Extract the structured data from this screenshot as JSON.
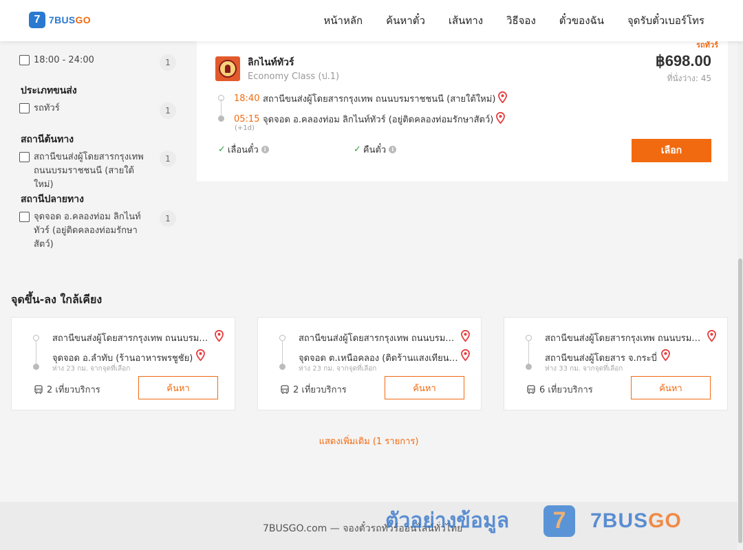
{
  "header": {
    "logo_mark": "7",
    "logo_brand": "7BUS",
    "logo_brand_go": "GO",
    "nav": [
      "หน้าหลัก",
      "ค้นหาตั๋ว",
      "เส้นทาง",
      "วิธีจอง",
      "ตั๋วของฉัน",
      "จุดรับตั๋วเบอร์โทร"
    ]
  },
  "filters": {
    "time": {
      "option": "18:00 - 24:00",
      "count": "1"
    },
    "type": {
      "title": "ประเภทขนส่ง",
      "option": "รถทัวร์",
      "count": "1"
    },
    "origin": {
      "title": "สถานีต้นทาง",
      "option": "สถานีขนส่งผู้โดยสารกรุงเทพ ถนนบรมราชชนนี (สายใต้ใหม่)",
      "count": "1"
    },
    "destination": {
      "title": "สถานีปลายทาง",
      "option": "จุดจอด อ.คลองท่อม ลิกไนท์ทัวร์ (อยู่ติดคลองท่อมรักษาสัตว์)",
      "count": "1"
    }
  },
  "trip": {
    "tag": "รถทัวร์",
    "operator": "ลิกไนท์ทัวร์",
    "class": "Economy Class (ป.1)",
    "price": "฿698.00",
    "seats": "ที่นั่งว่าง: 45",
    "depart_time": "18:40",
    "depart_station": "สถานีขนส่งผู้โดยสารกรุงเทพ ถนนบรมราชชนนี (สายใต้ใหม่)",
    "arrive_time": "05:15",
    "arrive_station": "จุดจอด อ.คลองท่อม ลิกไนท์ทัวร์ (อยู่ติดคลองท่อมรักษาสัตว์)",
    "plus_day": "(+1d)",
    "feature_1": "เลื่อนตั๋ว",
    "feature_2": "คืนตั๋ว",
    "select_label": "เลือก"
  },
  "nearby": {
    "title": "จุดขึ้น-ลง ใกล้เคียง",
    "cards": [
      {
        "from": "สถานีขนส่งผู้โดยสารกรุงเทพ ถนนบรมราชชนนี (สายใต้ใหม่)",
        "to": "จุดจอด อ.ลำทับ (ร้านอาหารพรชูชัย)",
        "distance": "ห่าง 23 กม. จากจุดที่เลือก",
        "trips": "2 เที่ยวบริการ",
        "button": "ค้นหา"
      },
      {
        "from": "สถานีขนส่งผู้โดยสารกรุงเทพ ถนนบรมราชชนนี (สายใต้ใหม่)",
        "to": "จุดจอด ต.เหนือคลอง (ติดร้านแสงเทียนการยาง)",
        "distance": "ห่าง 23 กม. จากจุดที่เลือก",
        "trips": "2 เที่ยวบริการ",
        "button": "ค้นหา"
      },
      {
        "from": "สถานีขนส่งผู้โดยสารกรุงเทพ ถนนบรมราชชนนี (สายใต้ใหม่)",
        "to": "สถานีขนส่งผู้โดยสาร จ.กระบี่",
        "distance": "ห่าง 33 กม. จากจุดที่เลือก",
        "trips": "6 เที่ยวบริการ",
        "button": "ค้นหา"
      }
    ],
    "show_more": "แสดงเพิ่มเติม (1 รายการ)"
  },
  "footer": {
    "text": "7BUSGO.com — จองตั๋วรถทัวร์ออนไลน์ทั่วไทย"
  },
  "watermark": {
    "text": "ตัวอย่างข้อมูล",
    "mark": "7",
    "brand": "7BUS",
    "brand_go": "GO"
  },
  "colors": {
    "accent": "#f26a10",
    "brand_blue": "#2a78d0",
    "check_green": "#2e9e3e"
  }
}
